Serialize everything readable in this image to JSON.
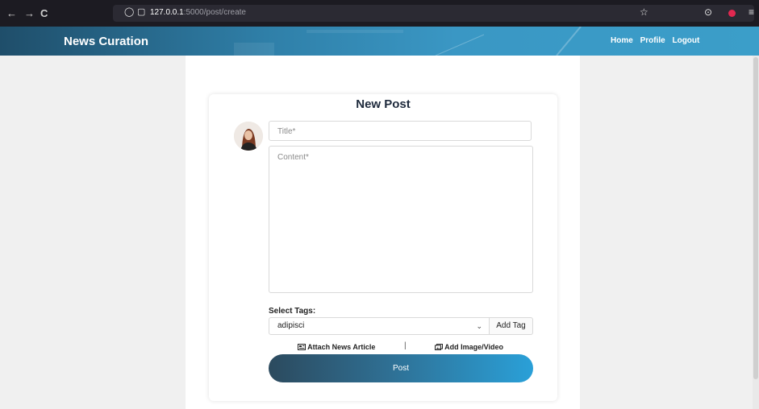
{
  "browser": {
    "url_host": "127.0.0.1",
    "url_path": ":5000/post/create",
    "back_icon": "←",
    "forward_icon": "→",
    "reload_icon": "C",
    "shield_icon": "◯",
    "page_icon": "▢",
    "star_icon": "☆",
    "pocket_icon": "⊙",
    "menu_icon": "≡"
  },
  "header": {
    "brand": "News Curation",
    "nav": [
      "Home",
      "Profile",
      "Logout"
    ]
  },
  "form": {
    "heading": "New Post",
    "title_placeholder": "Title*",
    "content_placeholder": "Content*",
    "tags_label": "Select Tags:",
    "selected_tag": "adipisci",
    "add_tag_label": "Add Tag",
    "attach_article_label": "Attach News Article",
    "separator": "|",
    "add_media_label": "Add Image/Video",
    "post_label": "Post"
  }
}
